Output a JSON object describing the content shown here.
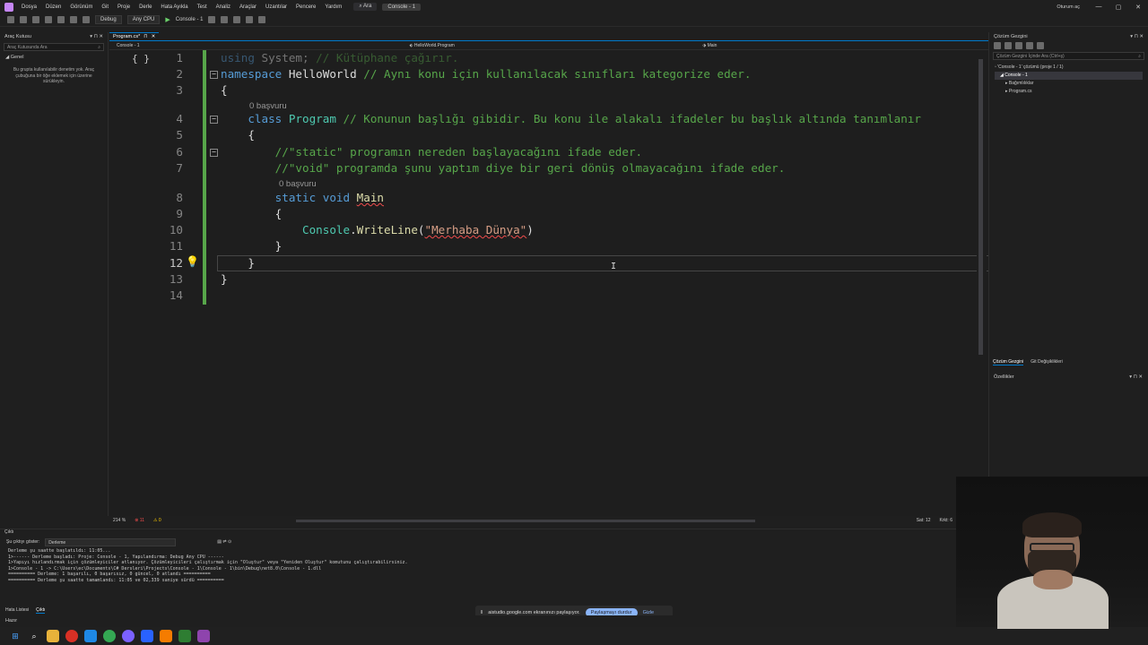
{
  "titlebar": {
    "menu": [
      "Dosya",
      "Düzen",
      "Görünüm",
      "Git",
      "Proje",
      "Derle",
      "Hata Ayıkla",
      "Test",
      "Analiz",
      "Araçlar",
      "Uzantılar",
      "Pencere",
      "Yardım"
    ],
    "search": "Ara",
    "solution_name": "Console - 1",
    "sign_in": "Oturum aç",
    "min": "—",
    "max": "▢",
    "close": "✕"
  },
  "toolbar": {
    "config": "Debug",
    "platform": "Any CPU",
    "run_target": "Console - 1"
  },
  "toolbox": {
    "title": "Araç Kutusu",
    "search_placeholder": "Araç Kutusunda Ara",
    "group": "Genel",
    "message": "Bu grupta kullanılabilir denetim yok. Araç çubuğuna bir öğe eklemek için üzerine sürükleyin."
  },
  "editor": {
    "tab_label": "Program.cs*",
    "project_dd": "Console - 1",
    "class_dd": "HelloWorld.Program",
    "member_dd": "Main",
    "lens_refs": "0 başvuru",
    "zoom": "214 %",
    "errors": "11",
    "warnings": "0",
    "position": "Sat: 12",
    "char": "Krkt: 6",
    "lines": [
      {
        "n": "1",
        "parts": [
          {
            "c": "kw dim",
            "t": "using "
          },
          {
            "c": "pl dim",
            "t": "System; "
          },
          {
            "c": "cm dim",
            "t": "// Kütüphane çağırır."
          }
        ]
      },
      {
        "n": "2",
        "parts": [
          {
            "c": "kw",
            "t": "namespace "
          },
          {
            "c": "pl",
            "t": "HelloWorld "
          },
          {
            "c": "cm",
            "t": "// Aynı konu için kullanılacak sınıfları kategorize eder."
          }
        ]
      },
      {
        "n": "3",
        "parts": [
          {
            "c": "pl",
            "t": "{"
          }
        ]
      },
      {
        "n": "4",
        "parts": [
          {
            "c": "pl",
            "t": "    "
          },
          {
            "c": "kw",
            "t": "class "
          },
          {
            "c": "cls",
            "t": "Program "
          },
          {
            "c": "cm",
            "t": "// Konunun başlığı gibidir. Bu konu ile alakalı ifadeler bu başlık altında tanımlanır"
          }
        ]
      },
      {
        "n": "5",
        "parts": [
          {
            "c": "pl",
            "t": "    {"
          }
        ]
      },
      {
        "n": "6",
        "parts": [
          {
            "c": "pl",
            "t": "        "
          },
          {
            "c": "cm",
            "t": "//\"static\" programın nereden başlayacağını ifade eder."
          }
        ]
      },
      {
        "n": "7",
        "parts": [
          {
            "c": "pl",
            "t": "        "
          },
          {
            "c": "cm",
            "t": "//\"void\" programda şunu yaptım diye bir geri dönüş olmayacağını ifade eder."
          }
        ]
      },
      {
        "n": "8",
        "parts": [
          {
            "c": "pl",
            "t": "        "
          },
          {
            "c": "kw",
            "t": "static void "
          },
          {
            "c": "fn squig",
            "t": "Main"
          }
        ]
      },
      {
        "n": "9",
        "parts": [
          {
            "c": "pl",
            "t": "        {"
          }
        ]
      },
      {
        "n": "10",
        "parts": [
          {
            "c": "pl",
            "t": "            "
          },
          {
            "c": "cls",
            "t": "Console"
          },
          {
            "c": "pl",
            "t": "."
          },
          {
            "c": "fn",
            "t": "WriteLine"
          },
          {
            "c": "pl",
            "t": "("
          },
          {
            "c": "str squig",
            "t": "\"Merhaba Dünya\""
          },
          {
            "c": "pl",
            "t": ")"
          }
        ]
      },
      {
        "n": "11",
        "parts": [
          {
            "c": "pl",
            "t": "        }"
          }
        ]
      },
      {
        "n": "12",
        "parts": [
          {
            "c": "pl",
            "t": "    }"
          }
        ]
      },
      {
        "n": "13",
        "parts": [
          {
            "c": "pl",
            "t": "}"
          }
        ]
      },
      {
        "n": "14",
        "parts": [
          {
            "c": "pl",
            "t": ""
          }
        ]
      }
    ]
  },
  "solution_explorer": {
    "title": "Çözüm Gezgini",
    "search_placeholder": "Çözüm Gezgini İçinde Ara (Ctrl+ş)",
    "items": [
      "'Console - 1' çözümü (proje 1 / 1)",
      "Console - 1",
      "Bağımlılıklar",
      "Program.cs"
    ],
    "tab_solution": "Çözüm Gezgini",
    "tab_git": "Git Değişiklikleri",
    "properties_title": "Özellikler"
  },
  "output": {
    "title": "Çıktı",
    "source_label": "Şu çıktıyı göster:",
    "source_value": "Derleme",
    "text": "Derleme şu saatte başlatıldı: 11:05...\n1>------ Derleme başladı: Proje: Console - 1, Yapılandırma: Debug Any CPU ------\n1>Yapıyı hızlandırmak için çözümleyiciler atlanıyor. Çözümleyicileri çalıştırmak için \"Oluştur\" veya \"Yeniden Oluştur\" komutunu çalıştırabilirsiniz.\n1>Console - 1 -> C:\\Users\\ec\\Documents\\C# Dersleri\\Projects\\Console - 1\\Console - 1\\bin\\Debug\\net8.0\\Console - 1.dll\n========== Derleme: 1 başarılı, 0 başarısız, 0 güncel, 0 atlandı ==========\n========== Derleme şu saatte tamamlandı: 11:05 ve 02,339 saniye sürdü =========="
  },
  "bottom_tabs": [
    "Hata Listesi",
    "Çıktı"
  ],
  "status": "Hazır",
  "share_bar": {
    "text": "aistudio.google.com ekranınızı paylaşıyor.",
    "stop": "Paylaşmayı durdur",
    "hide": "Gizle"
  },
  "colors": {
    "accent": "#007acc",
    "keyword": "#569cd6",
    "comment": "#57a64a",
    "type": "#4ec9b0"
  }
}
